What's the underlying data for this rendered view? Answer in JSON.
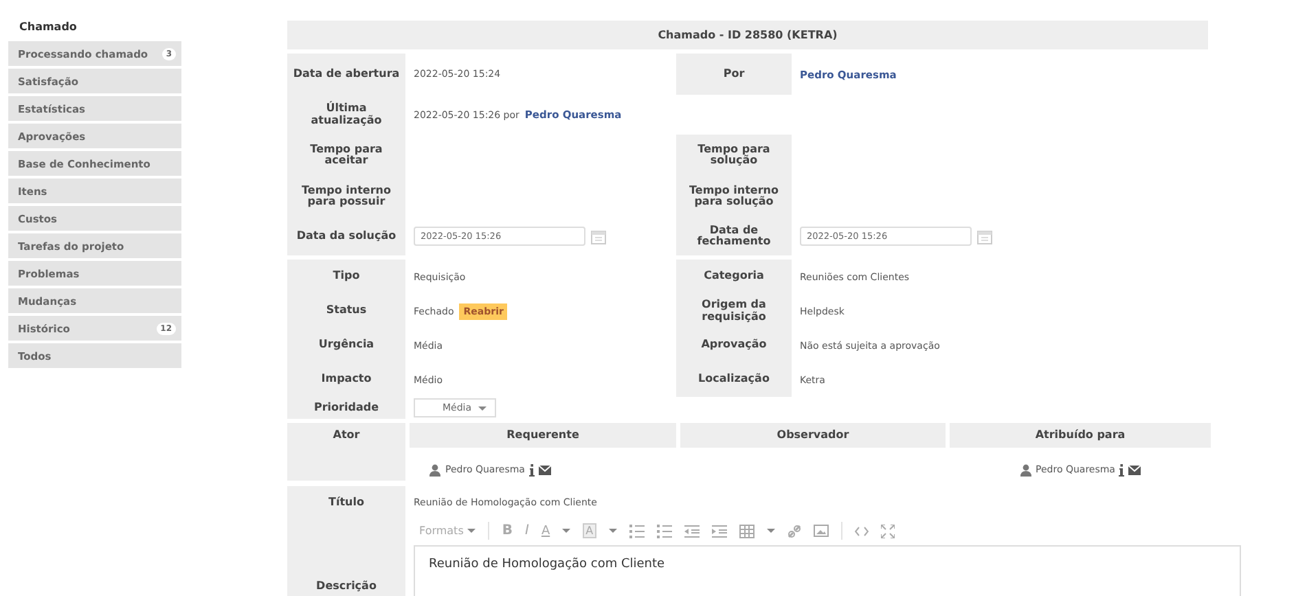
{
  "sidebar": {
    "title": "Chamado",
    "items": [
      {
        "label": "Processando chamado",
        "badge": "3"
      },
      {
        "label": "Satisfação"
      },
      {
        "label": "Estatísticas"
      },
      {
        "label": "Aprovações"
      },
      {
        "label": "Base de Conhecimento"
      },
      {
        "label": "Itens"
      },
      {
        "label": "Custos"
      },
      {
        "label": "Tarefas do projeto"
      },
      {
        "label": "Problemas"
      },
      {
        "label": "Mudanças"
      },
      {
        "label": "Histórico",
        "badge": "12"
      },
      {
        "label": "Todos"
      }
    ]
  },
  "ticket": {
    "title": "Chamado - ID 28580 (KETRA)",
    "groups": [
      [
        {
          "label": "Data de abertura",
          "value": {
            "kind": "text",
            "text": "2022-05-20 15:24"
          },
          "right_label": "Por",
          "right_value": {
            "kind": "link",
            "text": "Pedro Quaresma"
          }
        },
        {
          "label": "Última atualização",
          "value": {
            "kind": "updated",
            "text": "2022-05-20 15:26 por",
            "link": "Pedro Quaresma"
          }
        },
        {
          "label": "Tempo para aceitar",
          "right_label": "Tempo para solução"
        },
        {
          "label": "Tempo interno para possuir",
          "right_label": "Tempo interno para solução"
        },
        {
          "label": "Data da solução",
          "value": {
            "kind": "date",
            "text": "2022-05-20 15:26"
          },
          "right_label": "Data de fechamento",
          "right_value": {
            "kind": "date",
            "text": "2022-05-20 15:26"
          }
        }
      ],
      [
        {
          "label": "Tipo",
          "value": {
            "kind": "text",
            "text": "Requisição"
          },
          "right_label": "Categoria",
          "right_value": {
            "kind": "text",
            "text": "Reuniões com Clientes"
          }
        },
        {
          "label": "Status",
          "value": {
            "kind": "status",
            "text": "Fechado",
            "action": "Reabrir"
          },
          "right_label": "Origem da requisição",
          "right_value": {
            "kind": "text",
            "text": "Helpdesk"
          }
        },
        {
          "label": "Urgência",
          "value": {
            "kind": "text",
            "text": "Média"
          },
          "right_label": "Aprovação",
          "right_value": {
            "kind": "text",
            "text": "Não está sujeita a aprovação"
          }
        },
        {
          "label": "Impacto",
          "value": {
            "kind": "text",
            "text": "Médio"
          },
          "right_label": "Localização",
          "right_value": {
            "kind": "text",
            "text": "Ketra"
          }
        },
        {
          "label": "Prioridade",
          "value": {
            "kind": "select",
            "text": "Média"
          }
        }
      ]
    ],
    "actors": {
      "label": "Ator",
      "columns": [
        {
          "heading": "Requerente",
          "people": [
            "Pedro Quaresma"
          ]
        },
        {
          "heading": "Observador"
        },
        {
          "heading": "Atribuído para",
          "people": [
            "Pedro Quaresma"
          ]
        }
      ]
    },
    "title_row": {
      "label": "Título",
      "value": "Reunião de Homologação com Cliente"
    },
    "description": {
      "label": "Descrição",
      "toolbar": {
        "formats": "Formats",
        "bold": "B",
        "italic": "I",
        "text_color": "A",
        "background_color": "A"
      },
      "text": "Reunião de Homologação com Cliente"
    }
  }
}
